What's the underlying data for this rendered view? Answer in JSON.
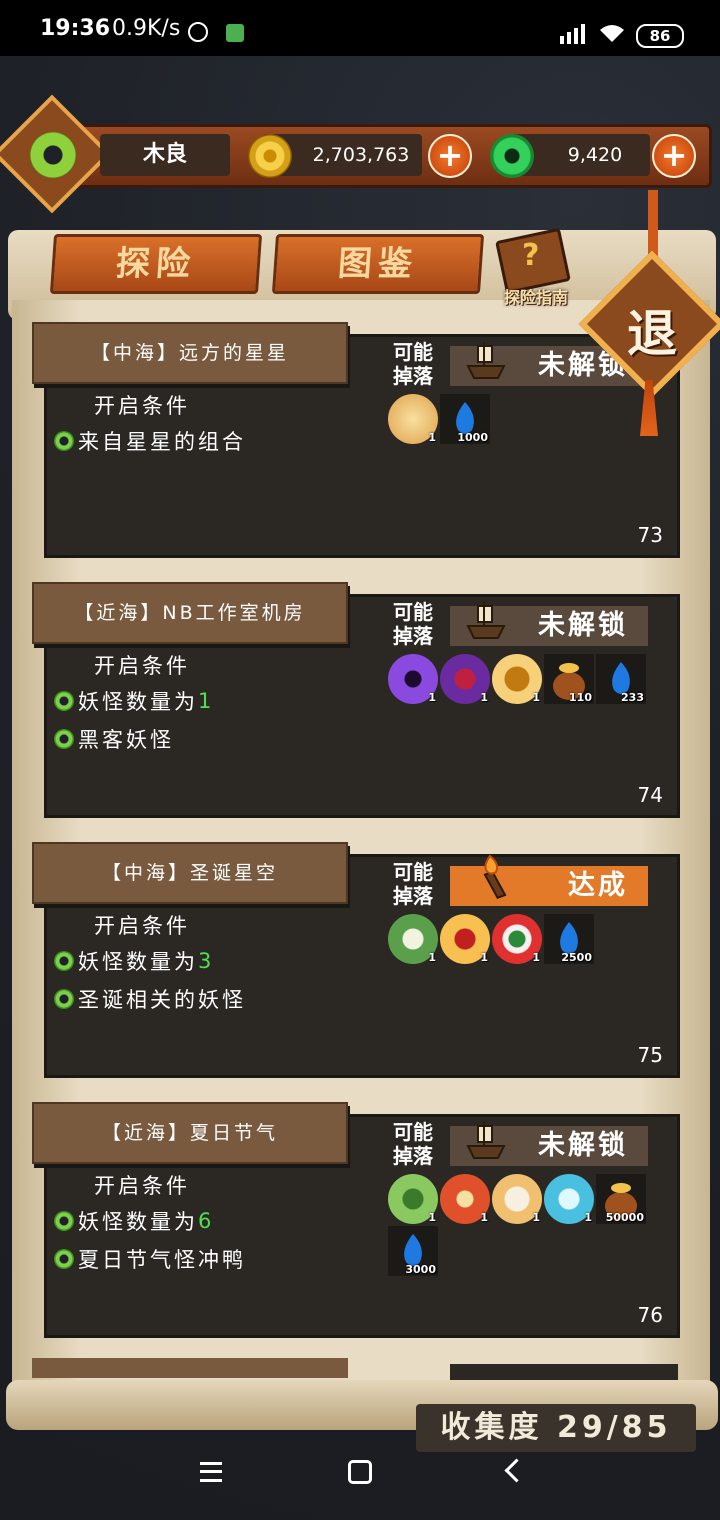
{
  "status_bar": {
    "time": "19:36",
    "net_speed": "0.9K/s",
    "battery": "86"
  },
  "header": {
    "player_name": "木良",
    "coins": "2,703,763",
    "jade": "9,420"
  },
  "tabs": [
    {
      "label": "探险"
    },
    {
      "label": "图鉴"
    }
  ],
  "guide_label": "探险指南",
  "exit_label": "退",
  "drop_label": "可能\n掉落",
  "condition_heading": "开启条件",
  "cards": [
    {
      "title": "【中海】远方的星星",
      "status": "未解锁",
      "conditions": [
        "来自星星的组合"
      ],
      "items": [
        {
          "icon": "star-scroll-icon",
          "qty": "1"
        },
        {
          "icon": "blue-flame-icon",
          "qty": "1000"
        }
      ],
      "number": "73"
    },
    {
      "title": "【近海】NB工作室机房",
      "status": "未解锁",
      "conditions_prefix": "妖怪数量为",
      "conditions_value": "1",
      "conditions": [
        "黑客妖怪"
      ],
      "items": [
        {
          "icon": "purple-eye-icon",
          "qty": "1"
        },
        {
          "icon": "heart-mask-icon",
          "qty": "1"
        },
        {
          "icon": "golden-beetle-icon",
          "qty": "1"
        },
        {
          "icon": "money-bag-icon",
          "qty": "110"
        },
        {
          "icon": "blue-flame-icon",
          "qty": "233"
        }
      ],
      "number": "74"
    },
    {
      "title": "【中海】圣诞星空",
      "status": "达成",
      "conditions_prefix": "妖怪数量为",
      "conditions_value": "3",
      "conditions": [
        "圣诞相关的妖怪"
      ],
      "items": [
        {
          "icon": "santa-cat-icon",
          "qty": "1"
        },
        {
          "icon": "bell-icon",
          "qty": "1"
        },
        {
          "icon": "candy-cane-icon",
          "qty": "1"
        },
        {
          "icon": "blue-flame-icon",
          "qty": "2500"
        }
      ],
      "number": "75"
    },
    {
      "title": "【近海】夏日节气",
      "status": "未解锁",
      "conditions_prefix": "妖怪数量为",
      "conditions_value": "6",
      "conditions": [
        "夏日节气怪冲鸭"
      ],
      "items": [
        {
          "icon": "green-leaf-icon",
          "qty": "1"
        },
        {
          "icon": "fire-triangle-icon",
          "qty": "1"
        },
        {
          "icon": "wheat-bun-icon",
          "qty": "1"
        },
        {
          "icon": "ice-crystal-icon",
          "qty": "1"
        },
        {
          "icon": "money-bag-icon",
          "qty": "50000"
        },
        {
          "icon": "blue-flame-icon",
          "qty": "3000"
        }
      ],
      "number": "76"
    }
  ],
  "collection": "收集度  29/85"
}
